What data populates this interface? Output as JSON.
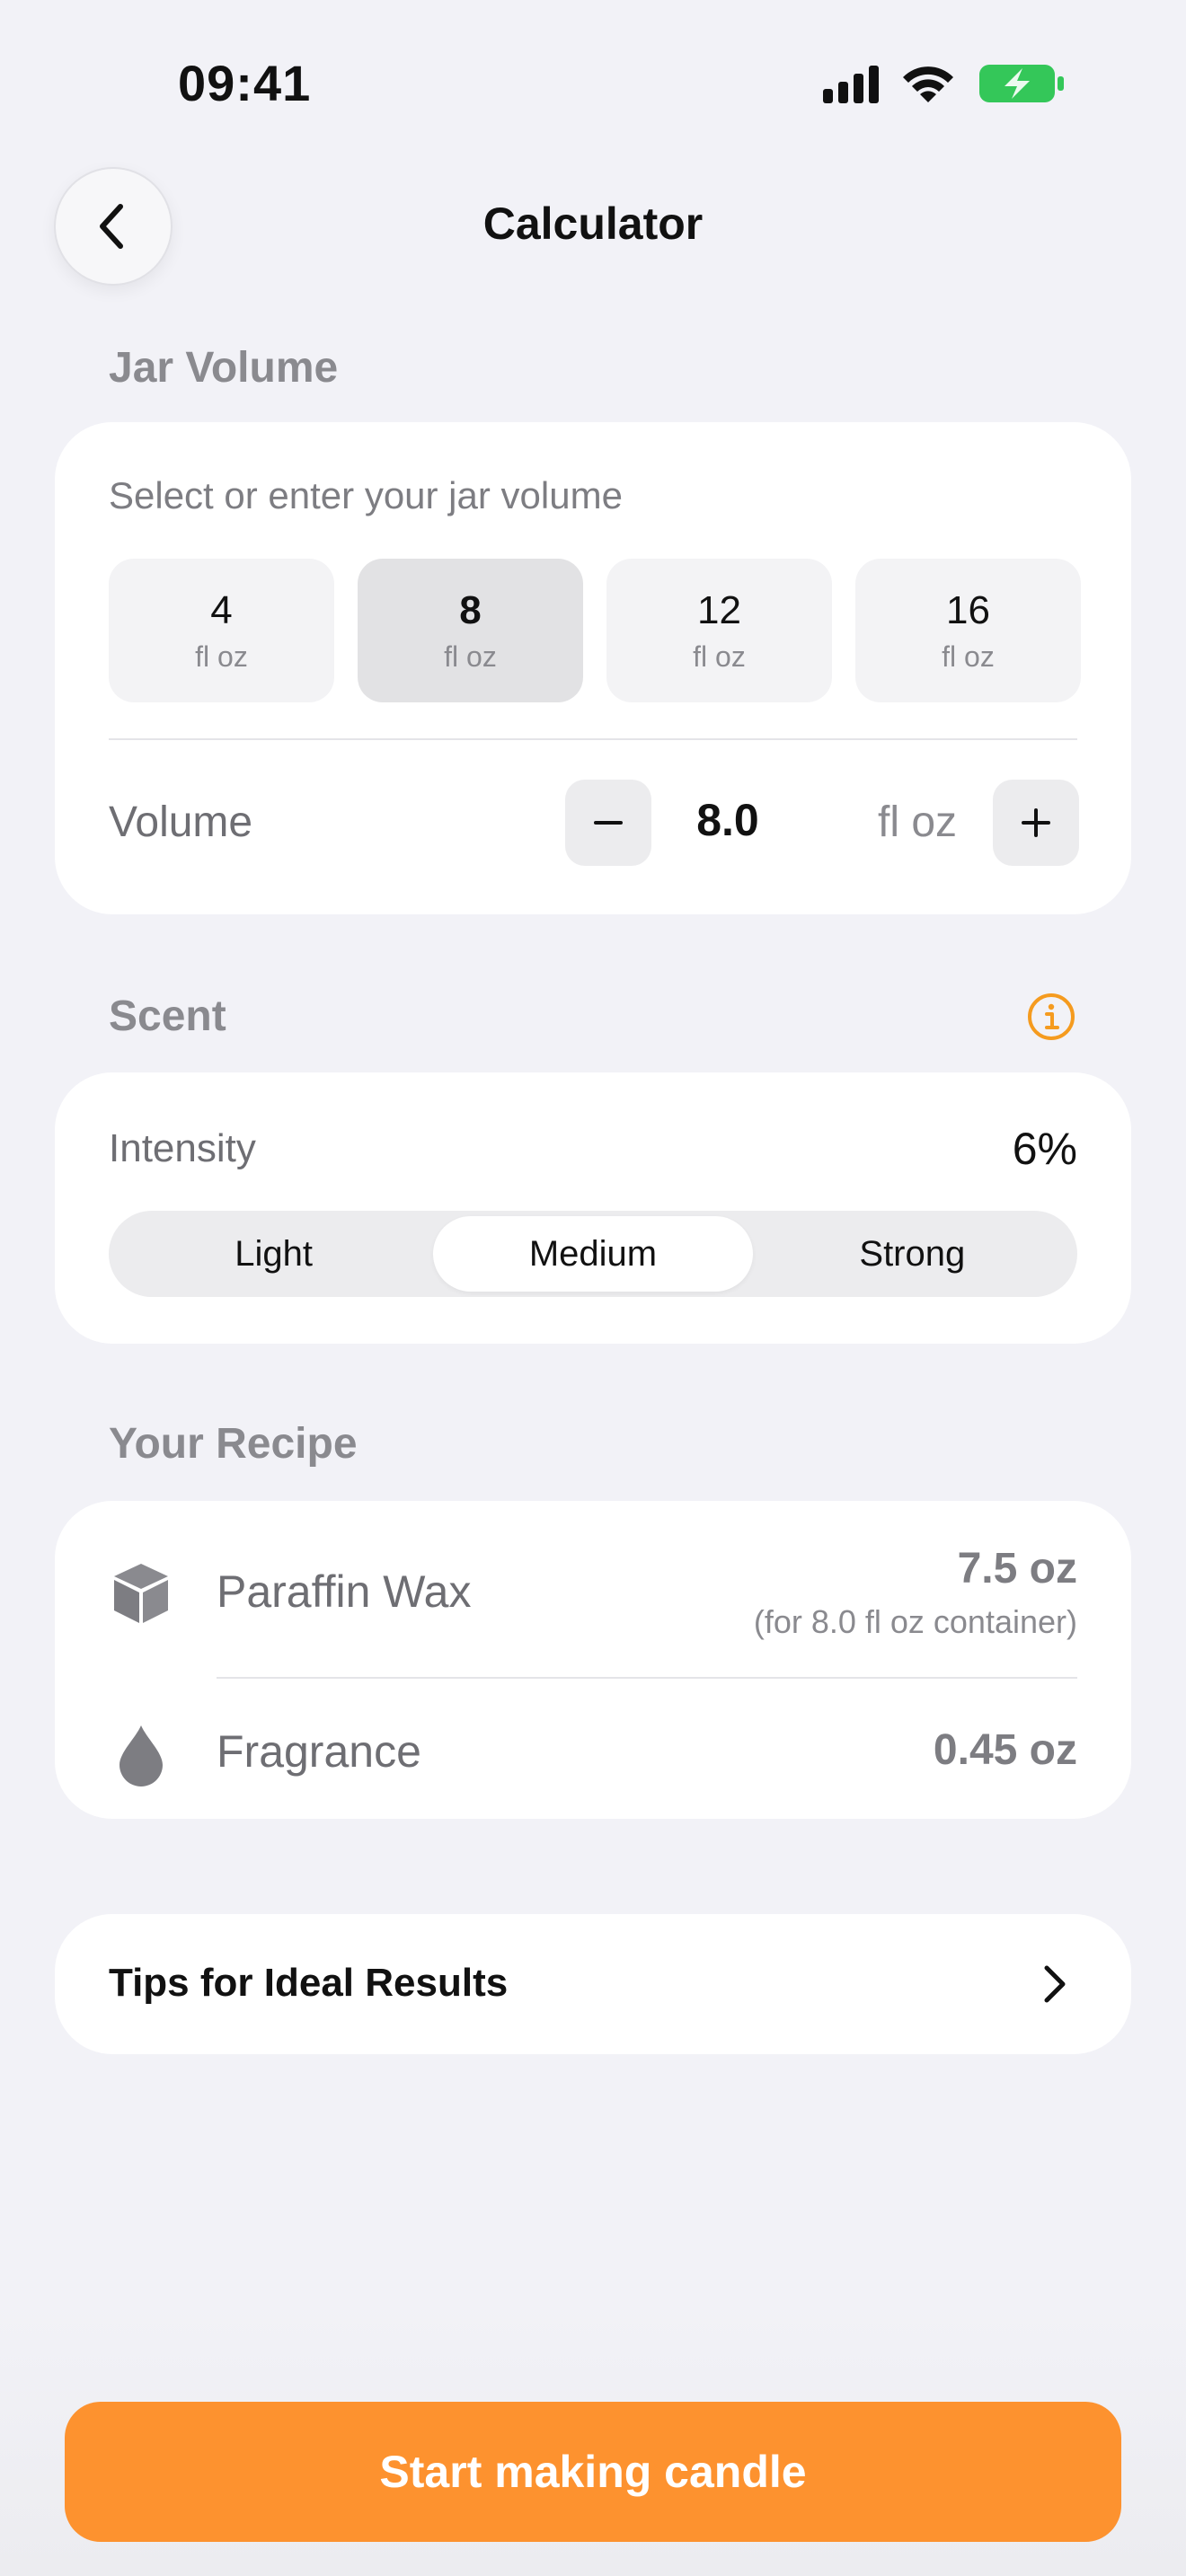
{
  "status_bar": {
    "time": "09:41"
  },
  "nav": {
    "title": "Calculator"
  },
  "jar_volume": {
    "section_title": "Jar Volume",
    "hint": "Select or enter your jar volume",
    "presets": [
      {
        "value": "4",
        "unit": "fl oz",
        "selected": false
      },
      {
        "value": "8",
        "unit": "fl oz",
        "selected": true
      },
      {
        "value": "12",
        "unit": "fl oz",
        "selected": false
      },
      {
        "value": "16",
        "unit": "fl oz",
        "selected": false
      }
    ],
    "volume_label": "Volume",
    "minus_label": "−",
    "volume_value": "8.0",
    "volume_unit": "fl oz",
    "plus_label": "+"
  },
  "scent": {
    "section_title": "Scent",
    "intensity_label": "Intensity",
    "intensity_value": "6%",
    "options": [
      "Light",
      "Medium",
      "Strong"
    ],
    "selected_option": "Medium"
  },
  "recipe": {
    "section_title": "Your Recipe",
    "items": [
      {
        "name": "Paraffin Wax",
        "amount": "7.5 oz",
        "note": "(for 8.0 fl oz container)",
        "icon": "cube-icon"
      },
      {
        "name": "Fragrance",
        "amount": "0.45 oz",
        "icon": "droplet-icon"
      }
    ]
  },
  "tips": {
    "label": "Tips for Ideal Results"
  },
  "cta": {
    "label": "Start making candle"
  },
  "colors": {
    "accent": "#fd922f",
    "background": "#f2f2f7",
    "card": "#ffffff",
    "battery_green": "#34c759",
    "info_orange": "#f59b1f"
  }
}
